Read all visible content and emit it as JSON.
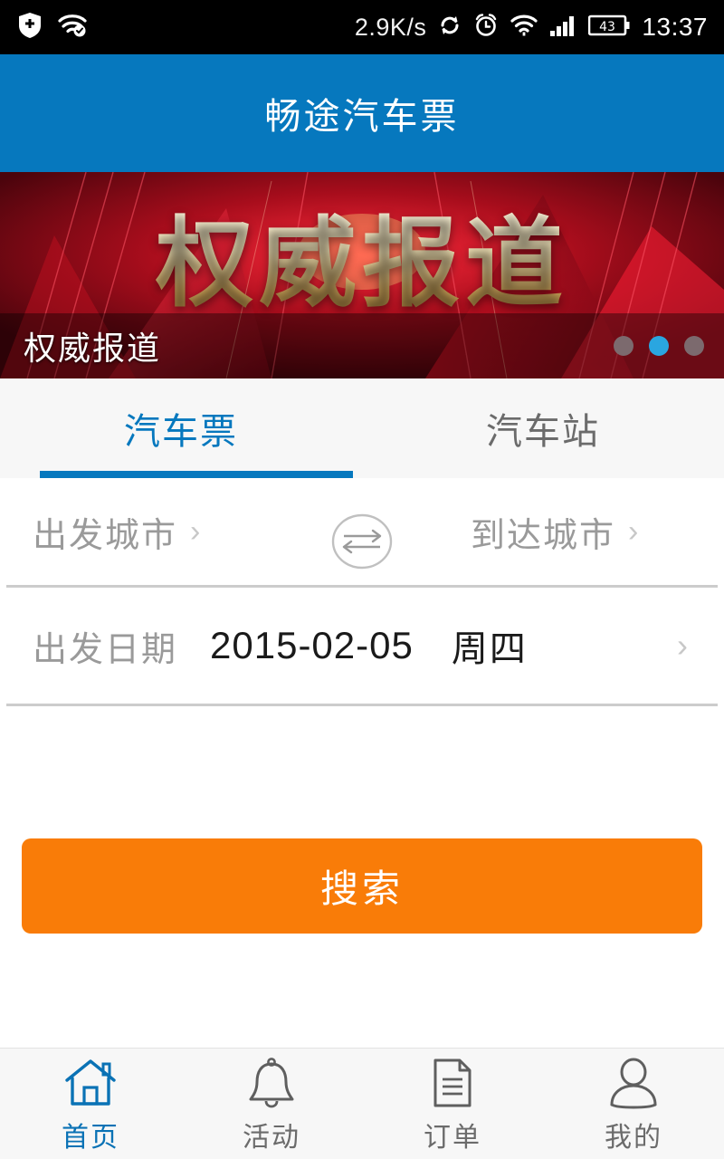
{
  "statusbar": {
    "left_icons": [
      "shield-check-icon",
      "wifi-eye-icon"
    ],
    "network_speed": "2.9K/s",
    "right_icons": [
      "sync-icon",
      "alarm-clock-icon",
      "wifi-icon",
      "signal-bars-icon"
    ],
    "battery_level": "43",
    "clock": "13:37"
  },
  "header": {
    "title": "畅途汽车票"
  },
  "banner": {
    "headline": "权威报道",
    "caption": "权威报道",
    "dots": [
      {
        "active": false
      },
      {
        "active": true
      },
      {
        "active": false
      }
    ],
    "active_index": 1
  },
  "tabs": [
    {
      "label": "汽车票",
      "active": true
    },
    {
      "label": "汽车站",
      "active": false
    }
  ],
  "form": {
    "from_city": "出发城市",
    "to_city": "到达城市",
    "swap_icon": "swap-arrows-icon",
    "date_label": "出发日期",
    "date_value": "2015-02-05",
    "date_weekday": "周四",
    "chevron": "›",
    "search_label": "搜索"
  },
  "bottom_nav": [
    {
      "label": "首页",
      "icon": "home-icon",
      "active": true
    },
    {
      "label": "活动",
      "icon": "bell-icon",
      "active": false
    },
    {
      "label": "订单",
      "icon": "document-icon",
      "active": false
    },
    {
      "label": "我的",
      "icon": "person-icon",
      "active": false
    }
  ],
  "colors": {
    "header_blue": "#0678be",
    "accent_blue": "#0678be",
    "search_orange": "#f97c08",
    "banner_red": "#6b0a12",
    "inactive_gray": "#6b6b6b",
    "placeholder_gray": "#9a9a9a"
  }
}
